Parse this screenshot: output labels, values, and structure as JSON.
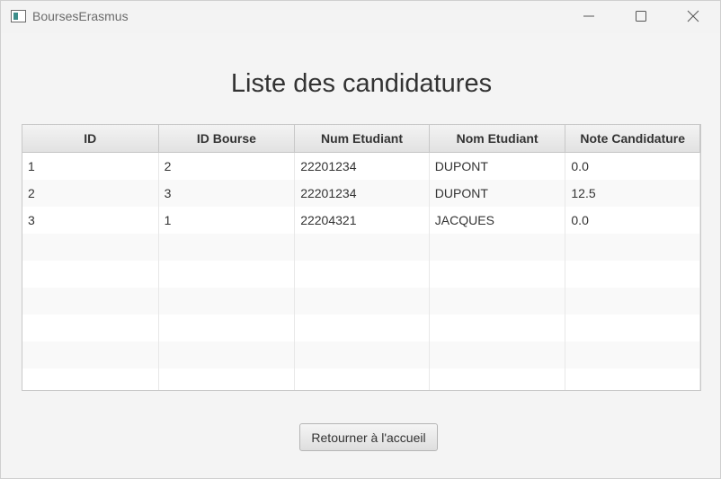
{
  "window": {
    "title": "BoursesErasmus"
  },
  "titlebar_icons": {
    "app": "window-app-icon",
    "minimize": "minimize-icon",
    "maximize": "maximize-icon",
    "close": "close-icon"
  },
  "heading": "Liste des candidatures",
  "table": {
    "columns": [
      "ID",
      "ID Bourse",
      "Num Etudiant",
      "Nom Etudiant",
      "Note Candidature"
    ],
    "rows": [
      [
        "1",
        "2",
        "22201234",
        "DUPONT",
        "0.0"
      ],
      [
        "2",
        "3",
        "22201234",
        "DUPONT",
        "12.5"
      ],
      [
        "3",
        "1",
        "22204321",
        "JACQUES",
        "0.0"
      ]
    ]
  },
  "back_button": {
    "label": "Retourner à l'accueil"
  }
}
